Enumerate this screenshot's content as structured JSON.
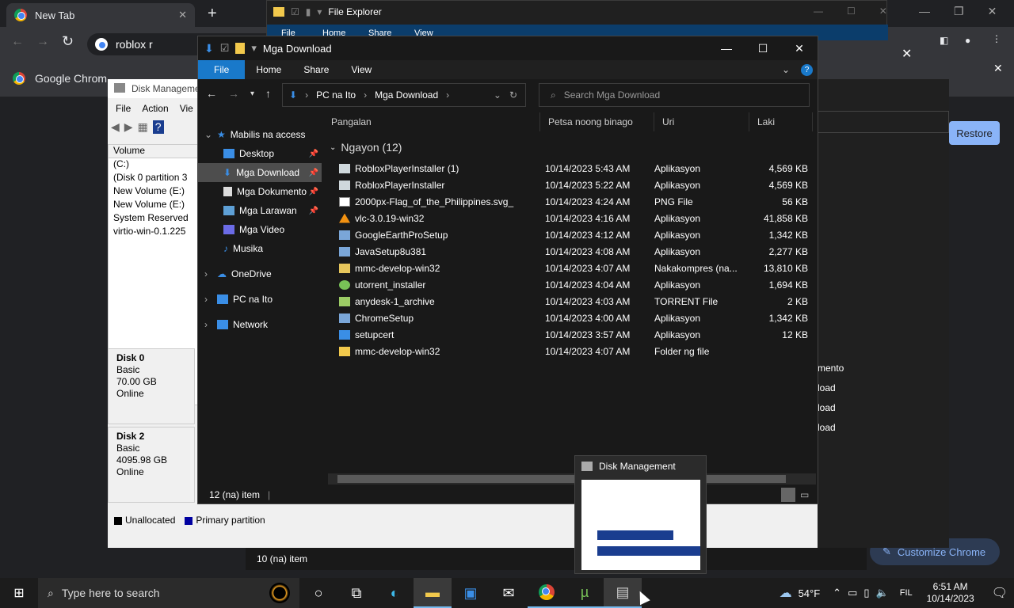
{
  "chrome": {
    "tab_title": "New Tab",
    "omnibox": "roblox r",
    "bookmark": "Google Chrom",
    "restore": "Restore",
    "customize": "Customize Chrome"
  },
  "explorer_back": {
    "title": "File Explorer",
    "ribbon": [
      "File",
      "Home",
      "Share",
      "View"
    ],
    "status": "10 (na) item"
  },
  "disk_mgmt": {
    "title": "Disk Manageme",
    "menu": [
      "File",
      "Action",
      "Vie"
    ],
    "col_header": "Volume",
    "volumes": [
      "(C:)",
      "(Disk 0 partition 3",
      "New Volume (E:)",
      "New Volume (E:)",
      "System Reserved",
      "virtio-win-0.1.225"
    ],
    "disks": [
      {
        "name": "Disk 0",
        "type": "Basic",
        "size": "70.00 GB",
        "status": "Online"
      },
      {
        "name": "Disk 2",
        "type": "Basic",
        "size": "4095.98 GB",
        "status": "Online"
      }
    ],
    "legend": [
      "Unallocated",
      "Primary partition"
    ],
    "right_items": [
      "mento",
      "load",
      "load",
      "load"
    ]
  },
  "explorer": {
    "title": "Mga Download",
    "ribbon": [
      "File",
      "Home",
      "Share",
      "View"
    ],
    "breadcrumb": [
      "PC na Ito",
      "Mga Download"
    ],
    "search_placeholder": "Search Mga Download",
    "nav": {
      "quick_access": "Mabilis na access",
      "items": [
        "Desktop",
        "Mga Download",
        "Mga Dokumento",
        "Mga Larawan",
        "Mga Video",
        "Musika"
      ],
      "onedrive": "OneDrive",
      "pc": "PC na Ito",
      "network": "Network"
    },
    "columns": [
      "Pangalan",
      "Petsa noong binago",
      "Uri",
      "Laki"
    ],
    "group": "Ngayon (12)",
    "files": [
      {
        "name": "RobloxPlayerInstaller (1)",
        "date": "10/14/2023 5:43 AM",
        "type": "Aplikasyon",
        "size": "4,569 KB",
        "icon": "roblox-icon"
      },
      {
        "name": "RobloxPlayerInstaller",
        "date": "10/14/2023 5:22 AM",
        "type": "Aplikasyon",
        "size": "4,569 KB",
        "icon": "roblox-icon"
      },
      {
        "name": "2000px-Flag_of_the_Philippines.svg_",
        "date": "10/14/2023 4:24 AM",
        "type": "PNG File",
        "size": "56 KB",
        "icon": "image-icon"
      },
      {
        "name": "vlc-3.0.19-win32",
        "date": "10/14/2023 4:16 AM",
        "type": "Aplikasyon",
        "size": "41,858 KB",
        "icon": "vlc-icon"
      },
      {
        "name": "GoogleEarthProSetup",
        "date": "10/14/2023 4:12 AM",
        "type": "Aplikasyon",
        "size": "1,342 KB",
        "icon": "setup-icon"
      },
      {
        "name": "JavaSetup8u381",
        "date": "10/14/2023 4:08 AM",
        "type": "Aplikasyon",
        "size": "2,277 KB",
        "icon": "setup-icon"
      },
      {
        "name": "mmc-develop-win32",
        "date": "10/14/2023 4:07 AM",
        "type": "Nakakompres (na...",
        "size": "13,810 KB",
        "icon": "zip-icon"
      },
      {
        "name": "utorrent_installer",
        "date": "10/14/2023 4:04 AM",
        "type": "Aplikasyon",
        "size": "1,694 KB",
        "icon": "utorrent-icon"
      },
      {
        "name": "anydesk-1_archive",
        "date": "10/14/2023 4:03 AM",
        "type": "TORRENT File",
        "size": "2 KB",
        "icon": "torrent-icon"
      },
      {
        "name": "ChromeSetup",
        "date": "10/14/2023 4:00 AM",
        "type": "Aplikasyon",
        "size": "1,342 KB",
        "icon": "setup-icon"
      },
      {
        "name": "setupcert",
        "date": "10/14/2023 3:57 AM",
        "type": "Aplikasyon",
        "size": "12 KB",
        "icon": "app-icon"
      },
      {
        "name": "mmc-develop-win32",
        "date": "10/14/2023 4:07 AM",
        "type": "Folder ng file",
        "size": "",
        "icon": "folder-icon"
      }
    ],
    "status": "12 (na) item"
  },
  "thumbnail": {
    "title": "Disk Management"
  },
  "taskbar": {
    "search": "Type here to search",
    "temp": "54°F",
    "lang": "FIL",
    "time": "6:51 AM",
    "date": "10/14/2023"
  }
}
